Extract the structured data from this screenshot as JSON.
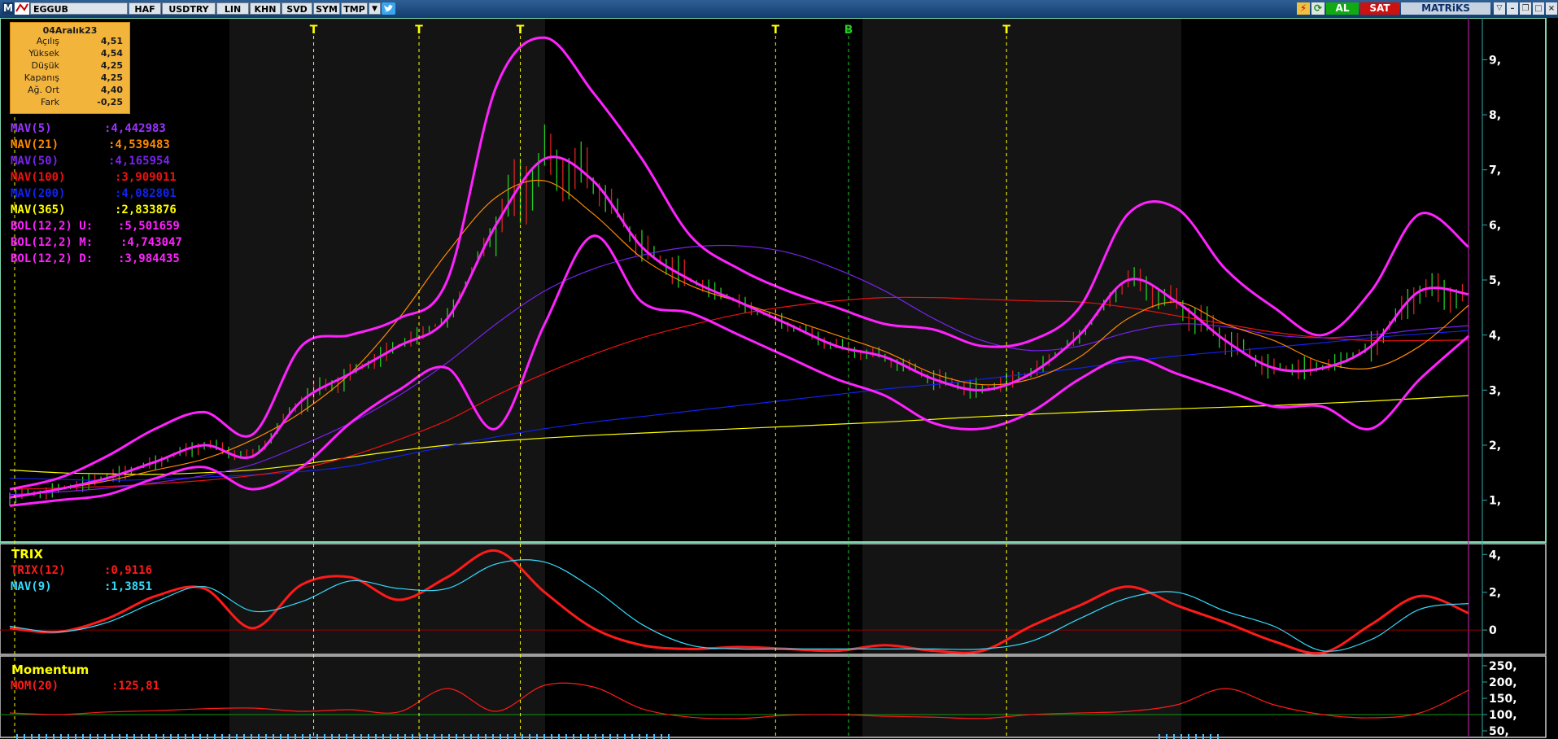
{
  "toolbar": {
    "menu_letter": "M",
    "symbol": "EGGUB",
    "buttons": [
      "HAF",
      "USDTRY",
      "LIN",
      "KHN",
      "SVD",
      "SYM",
      "TMP"
    ],
    "buy": "AL",
    "sell": "SAT",
    "brand": "MATRiKS",
    "icons": [
      "lightning-icon",
      "refresh-icon",
      "twitter-icon",
      "dropdown-icon"
    ]
  },
  "infobox": {
    "date": "04Aralık23",
    "rows": [
      {
        "label": "Açılış",
        "value": "4,51"
      },
      {
        "label": "Yüksek",
        "value": "4,54"
      },
      {
        "label": "Düşük",
        "value": "4,25"
      },
      {
        "label": "Kapanış",
        "value": "4,25"
      },
      {
        "label": "Ağ. Ort",
        "value": "4,40"
      },
      {
        "label": "Fark",
        "value": "-0,25"
      }
    ]
  },
  "indicators": [
    {
      "label": "MAV(5)",
      "value": ":4,442983",
      "color": "#9933ff"
    },
    {
      "label": "MAV(21)",
      "value": ":4,539483",
      "color": "#ff8800"
    },
    {
      "label": "MAV(50)",
      "value": ":4,165954",
      "color": "#7722ee"
    },
    {
      "label": "MAV(100)",
      "value": ":3,909011",
      "color": "#ee1111"
    },
    {
      "label": "MAV(200)",
      "value": ":4,082801",
      "color": "#1122ee"
    },
    {
      "label": "MAV(365)",
      "value": ":2,833876",
      "color": "#ffff00"
    },
    {
      "label": "BOL(12,2) U:",
      "value": ":5,501659",
      "color": "#ff22ff"
    },
    {
      "label": "BOL(12,2) M:",
      "value": ":4,743047",
      "color": "#ff22ff"
    },
    {
      "label": "BOL(12,2) D:",
      "value": ":3,984435",
      "color": "#ff22ff"
    }
  ],
  "trix_panel": {
    "title": "TRIX",
    "items": [
      {
        "label": "TRIX(12)",
        "value": ":0,9116",
        "color": "#ff1a1a"
      },
      {
        "label": "MAV(9)",
        "value": ":1,3851",
        "color": "#33ddff"
      }
    ]
  },
  "mom_panel": {
    "title": "Momentum",
    "items": [
      {
        "label": "MOM(20)",
        "value": ":125,81",
        "color": "#ff1a1a"
      }
    ]
  },
  "colors": {
    "price_up": "#22cc22",
    "price_down": "#dd2222",
    "bollinger": "#ff22ff",
    "signal_line": "#ffff00",
    "signal_buy": "#22cc22",
    "axis_text": "#ffffff"
  },
  "chart_data": [
    {
      "type": "line",
      "panel": "price",
      "x": [
        0,
        12,
        24,
        36,
        48,
        60,
        72,
        84,
        96,
        108,
        120,
        132,
        144,
        156,
        168,
        180,
        192,
        204,
        216,
        228,
        240,
        252,
        264,
        276,
        288,
        300,
        312,
        324,
        336,
        348,
        360
      ],
      "y_axis_ticks": [
        "1,",
        "2,",
        "3,",
        "4,",
        "5,",
        "6,",
        "7,",
        "8,",
        "9,"
      ],
      "ylim": [
        0.3,
        9.7
      ],
      "series": [
        {
          "name": "MAV(365)",
          "color": "#ffff00",
          "values": [
            1.55,
            1.5,
            1.48,
            1.47,
            1.5,
            1.55,
            1.65,
            1.78,
            1.9,
            2.0,
            2.07,
            2.13,
            2.18,
            2.22,
            2.26,
            2.3,
            2.34,
            2.38,
            2.42,
            2.47,
            2.52,
            2.56,
            2.6,
            2.63,
            2.66,
            2.69,
            2.72,
            2.76,
            2.8,
            2.85,
            2.9
          ]
        },
        {
          "name": "MAV(200)",
          "color": "#1122ee",
          "values": [
            1.4,
            1.38,
            1.36,
            1.38,
            1.42,
            1.46,
            1.52,
            1.62,
            1.8,
            1.98,
            2.15,
            2.3,
            2.42,
            2.52,
            2.62,
            2.72,
            2.82,
            2.92,
            3.02,
            3.1,
            3.2,
            3.3,
            3.4,
            3.52,
            3.62,
            3.7,
            3.78,
            3.86,
            3.95,
            4.02,
            4.08
          ]
        },
        {
          "name": "MAV(100)",
          "color": "#ee1111",
          "values": [
            1.2,
            1.22,
            1.25,
            1.3,
            1.36,
            1.45,
            1.58,
            1.8,
            2.1,
            2.45,
            2.9,
            3.3,
            3.65,
            3.95,
            4.18,
            4.38,
            4.52,
            4.62,
            4.68,
            4.68,
            4.65,
            4.62,
            4.6,
            4.5,
            4.35,
            4.2,
            4.05,
            3.95,
            3.9,
            3.9,
            3.91
          ]
        },
        {
          "name": "MAV(50)",
          "color": "#7722ee",
          "values": [
            1.1,
            1.15,
            1.22,
            1.32,
            1.45,
            1.65,
            2.0,
            2.4,
            2.9,
            3.5,
            4.2,
            4.8,
            5.2,
            5.45,
            5.6,
            5.62,
            5.5,
            5.2,
            4.8,
            4.3,
            3.9,
            3.72,
            3.8,
            4.05,
            4.2,
            4.15,
            4.0,
            3.95,
            4.0,
            4.1,
            4.17
          ]
        },
        {
          "name": "MAV(21)",
          "color": "#ff8800",
          "values": [
            1.05,
            1.2,
            1.35,
            1.55,
            1.75,
            2.1,
            2.6,
            3.3,
            4.3,
            5.5,
            6.5,
            6.8,
            6.2,
            5.4,
            4.9,
            4.6,
            4.3,
            4.0,
            3.7,
            3.3,
            3.1,
            3.2,
            3.6,
            4.3,
            4.6,
            4.2,
            3.9,
            3.5,
            3.4,
            3.8,
            4.54
          ]
        },
        {
          "name": "BOL(12,2) U",
          "color": "#ff22ff",
          "values": [
            1.2,
            1.4,
            1.8,
            2.3,
            2.6,
            2.2,
            3.8,
            4.0,
            4.3,
            5.0,
            8.5,
            9.4,
            8.4,
            7.2,
            5.8,
            5.2,
            4.8,
            4.5,
            4.2,
            4.1,
            3.8,
            3.9,
            4.5,
            6.2,
            6.3,
            5.2,
            4.5,
            4.0,
            4.8,
            6.2,
            5.6
          ]
        },
        {
          "name": "BOL(12,2) M",
          "color": "#ff22ff",
          "values": [
            1.05,
            1.2,
            1.4,
            1.7,
            2.0,
            1.8,
            2.8,
            3.3,
            3.8,
            4.3,
            6.0,
            7.2,
            6.8,
            5.6,
            5.0,
            4.6,
            4.2,
            3.8,
            3.6,
            3.2,
            3.0,
            3.3,
            4.0,
            5.0,
            4.6,
            3.9,
            3.4,
            3.4,
            3.8,
            4.8,
            4.74
          ]
        },
        {
          "name": "BOL(12,2) D",
          "color": "#ff22ff",
          "values": [
            0.9,
            1.0,
            1.1,
            1.4,
            1.6,
            1.2,
            1.6,
            2.4,
            3.0,
            3.4,
            2.3,
            4.2,
            5.8,
            4.6,
            4.4,
            4.0,
            3.6,
            3.2,
            2.9,
            2.4,
            2.3,
            2.6,
            3.2,
            3.6,
            3.3,
            3.0,
            2.7,
            2.7,
            2.3,
            3.2,
            3.98
          ]
        }
      ]
    },
    {
      "type": "line",
      "panel": "trix",
      "x": [
        0,
        12,
        24,
        36,
        48,
        60,
        72,
        84,
        96,
        108,
        120,
        132,
        144,
        156,
        168,
        180,
        192,
        204,
        216,
        228,
        240,
        252,
        264,
        276,
        288,
        300,
        312,
        324,
        336,
        348,
        360
      ],
      "y_axis_ticks": [
        "4,",
        "2,",
        "0"
      ],
      "ylim": [
        -1.2,
        4.4
      ],
      "series": [
        {
          "name": "TRIX(12)",
          "color": "#ff1a1a",
          "values": [
            0.1,
            -0.1,
            0.6,
            1.8,
            2.2,
            0.1,
            2.4,
            2.8,
            1.6,
            2.8,
            4.2,
            2.0,
            0.1,
            -0.8,
            -1.0,
            -0.9,
            -1.0,
            -1.1,
            -0.8,
            -1.1,
            -1.1,
            0.2,
            1.3,
            2.3,
            1.3,
            0.4,
            -0.6,
            -1.2,
            0.3,
            1.8,
            0.9
          ]
        },
        {
          "name": "MAV(9)",
          "color": "#33ddff",
          "values": [
            0.2,
            -0.1,
            0.4,
            1.5,
            2.3,
            1.0,
            1.5,
            2.6,
            2.2,
            2.2,
            3.5,
            3.6,
            2.2,
            0.3,
            -0.8,
            -1.0,
            -1.0,
            -1.0,
            -1.0,
            -1.0,
            -1.0,
            -0.6,
            0.6,
            1.7,
            2.0,
            1.0,
            0.2,
            -1.1,
            -0.5,
            1.1,
            1.4
          ]
        }
      ]
    },
    {
      "type": "line",
      "panel": "momentum",
      "x": [
        0,
        12,
        24,
        36,
        48,
        60,
        72,
        84,
        96,
        108,
        120,
        132,
        144,
        156,
        168,
        180,
        192,
        204,
        216,
        228,
        240,
        252,
        264,
        276,
        288,
        300,
        312,
        324,
        336,
        348,
        360
      ],
      "y_axis_ticks": [
        "250,",
        "200,",
        "150,",
        "100,",
        "50,"
      ],
      "ylim": [
        40,
        270
      ],
      "series": [
        {
          "name": "MOM(20)",
          "color": "#ff1a1a",
          "values": [
            105,
            100,
            108,
            112,
            118,
            120,
            110,
            115,
            108,
            180,
            110,
            190,
            185,
            118,
            92,
            88,
            98,
            100,
            95,
            92,
            88,
            100,
            105,
            110,
            130,
            180,
            130,
            100,
            90,
            105,
            175
          ]
        }
      ]
    }
  ],
  "signals": [
    {
      "label": "T",
      "x": 75,
      "color": "#ffff00"
    },
    {
      "label": "T",
      "x": 101,
      "color": "#ffff00"
    },
    {
      "label": "T",
      "x": 126,
      "color": "#ffff00"
    },
    {
      "label": "T",
      "x": 189,
      "color": "#ffff00"
    },
    {
      "label": "B",
      "x": 207,
      "color": "#22cc22"
    },
    {
      "label": "T",
      "x": 246,
      "color": "#ffff00"
    }
  ]
}
